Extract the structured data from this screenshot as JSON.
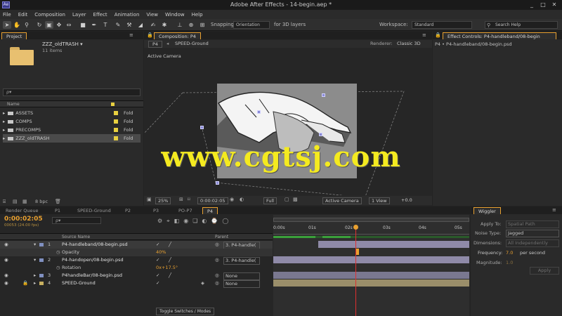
{
  "window": {
    "title": "Adobe After Effects - 14-begin.aep *",
    "app_icon": "Ae",
    "controls": [
      "_",
      "□",
      "✕"
    ]
  },
  "menu": [
    "File",
    "Edit",
    "Composition",
    "Layer",
    "Effect",
    "Animation",
    "View",
    "Window",
    "Help"
  ],
  "toolbar": {
    "tools": [
      "selection-tool",
      "hand-tool",
      "zoom-tool",
      "rotate-tool",
      "camera-tool",
      "pan-behind-tool",
      "rectangle-tool",
      "pen-tool",
      "type-tool",
      "brush-tool",
      "clone-stamp-tool",
      "eraser-tool",
      "roto-brush-tool",
      "puppet-tool"
    ],
    "snapping_label": "Snapping",
    "axis_label": "Orientation",
    "for_3d": "for 3D layers",
    "workspace_label": "Workspace:",
    "workspace_value": "Standard",
    "search_placeholder": "Search Help"
  },
  "project": {
    "tab": "Project",
    "folder_name": "ZZZ_oldTRASH ▾",
    "folder_items": "11 items",
    "search_placeholder": "ρ▾",
    "col_name": "Name",
    "items": [
      {
        "name": "ASSETS",
        "type": "Fold"
      },
      {
        "name": "COMPS",
        "type": "Fold"
      },
      {
        "name": "PRECOMPS",
        "type": "Fold"
      },
      {
        "name": "ZZZ_oldTRASH",
        "type": "Fold"
      }
    ],
    "footer_bpc": "8 bpc"
  },
  "composition": {
    "tab": "Composition: P4",
    "breadcrumb_1": "P4",
    "breadcrumb_2": "SPEED-Ground",
    "renderer_label": "Renderer:",
    "renderer_value": "Classic 3D",
    "view_label": "Active Camera",
    "zoom": "25%",
    "timecode": "0:00:02:05",
    "resolution": "Full",
    "camera": "Active Camera",
    "views": "1 View",
    "exposure": "+0.0"
  },
  "effect_controls": {
    "tab": "Effect Controls: P4-handleband/08-begin",
    "header": "P4 • P4-handleband/08-begin.psd"
  },
  "timeline": {
    "tabs": [
      "Render Queue",
      "P1",
      "SPEED-Ground",
      "P2",
      "P3",
      "PO-P7",
      "P4"
    ],
    "active_tab": "P4",
    "timecode": "0:00:02:05",
    "fps": "00053 (24.00 fps)",
    "search_placeholder": "ρ▾",
    "col_source": "Source Name",
    "col_parent": "Parent",
    "ruler": [
      "0:00s",
      "01s",
      "02s",
      "03s",
      "04s",
      "05s"
    ],
    "layers": [
      {
        "num": "1",
        "name": "P4-handleband/08-begin.psd",
        "parent": "3. P4-handle(",
        "prop": "Opacity",
        "prop_value": "40%"
      },
      {
        "num": "2",
        "name": "P4-handopen/08-begin.psd",
        "parent": "3. P4-handle(",
        "prop": "Rotation",
        "prop_value": "0x+17.5°"
      },
      {
        "num": "3",
        "name": "P4handleBar/08-begin.psd",
        "parent": "None"
      },
      {
        "num": "4",
        "name": "SPEED-Ground",
        "parent": "None"
      }
    ],
    "toggle_label": "Toggle Switches / Modes"
  },
  "wiggler": {
    "tab": "Wiggler",
    "apply_label": "Apply To:",
    "apply_value": "Spatial Path",
    "noise_label": "Noise Type:",
    "noise_value": "Jagged",
    "dimensions_label": "Dimensions:",
    "dimensions_value": "All Independently",
    "frequency_label": "Frequency:",
    "frequency_value": "7.0",
    "frequency_unit": "per second",
    "magnitude_label": "Magnitude:",
    "magnitude_value": "1.0",
    "apply_button": "Apply"
  },
  "watermark": "www.cgtsj.com",
  "colors": {
    "accent": "#e8a030",
    "timecode": "#e8a030",
    "label_yellow": "#e8d040",
    "layer_bar": "#8f8aa8",
    "watermark": "#f4ea20",
    "playhead": "#e03030"
  }
}
